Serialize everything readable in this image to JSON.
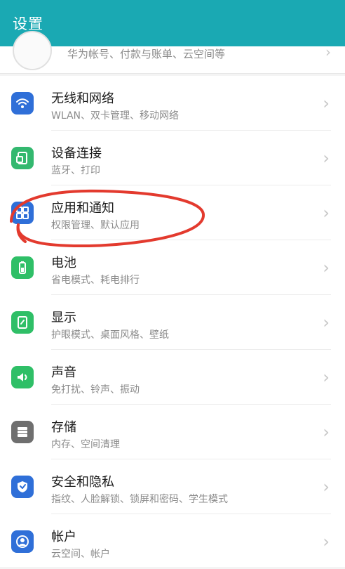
{
  "header": {
    "title": "设置"
  },
  "account": {
    "subtitle": "华为帐号、付款与账单、云空间等"
  },
  "items": [
    {
      "title": "无线和网络",
      "subtitle": "WLAN、双卡管理、移动网络",
      "icon": "wifi-icon",
      "color": "#2f6fd8"
    },
    {
      "title": "设备连接",
      "subtitle": "蓝牙、打印",
      "icon": "device-connect-icon",
      "color": "#33b86f"
    },
    {
      "title": "应用和通知",
      "subtitle": "权限管理、默认应用",
      "icon": "apps-grid-icon",
      "color": "#2f6fd8"
    },
    {
      "title": "电池",
      "subtitle": "省电模式、耗电排行",
      "icon": "battery-icon",
      "color": "#2fbf67"
    },
    {
      "title": "显示",
      "subtitle": "护眼模式、桌面风格、壁纸",
      "icon": "display-icon",
      "color": "#2fbf67"
    },
    {
      "title": "声音",
      "subtitle": "免打扰、铃声、振动",
      "icon": "speaker-icon",
      "color": "#2fbf67"
    },
    {
      "title": "存储",
      "subtitle": "内存、空间清理",
      "icon": "storage-icon",
      "color": "#6f6f6f"
    },
    {
      "title": "安全和隐私",
      "subtitle": "指纹、人脸解锁、锁屏和密码、学生模式",
      "icon": "shield-icon",
      "color": "#2f6fd8"
    },
    {
      "title": "帐户",
      "subtitle": "云空间、帐户",
      "icon": "account-icon",
      "color": "#2f6fd8"
    }
  ],
  "chevron": "›",
  "annotation": {
    "stroke_color": "#e33a2e"
  }
}
